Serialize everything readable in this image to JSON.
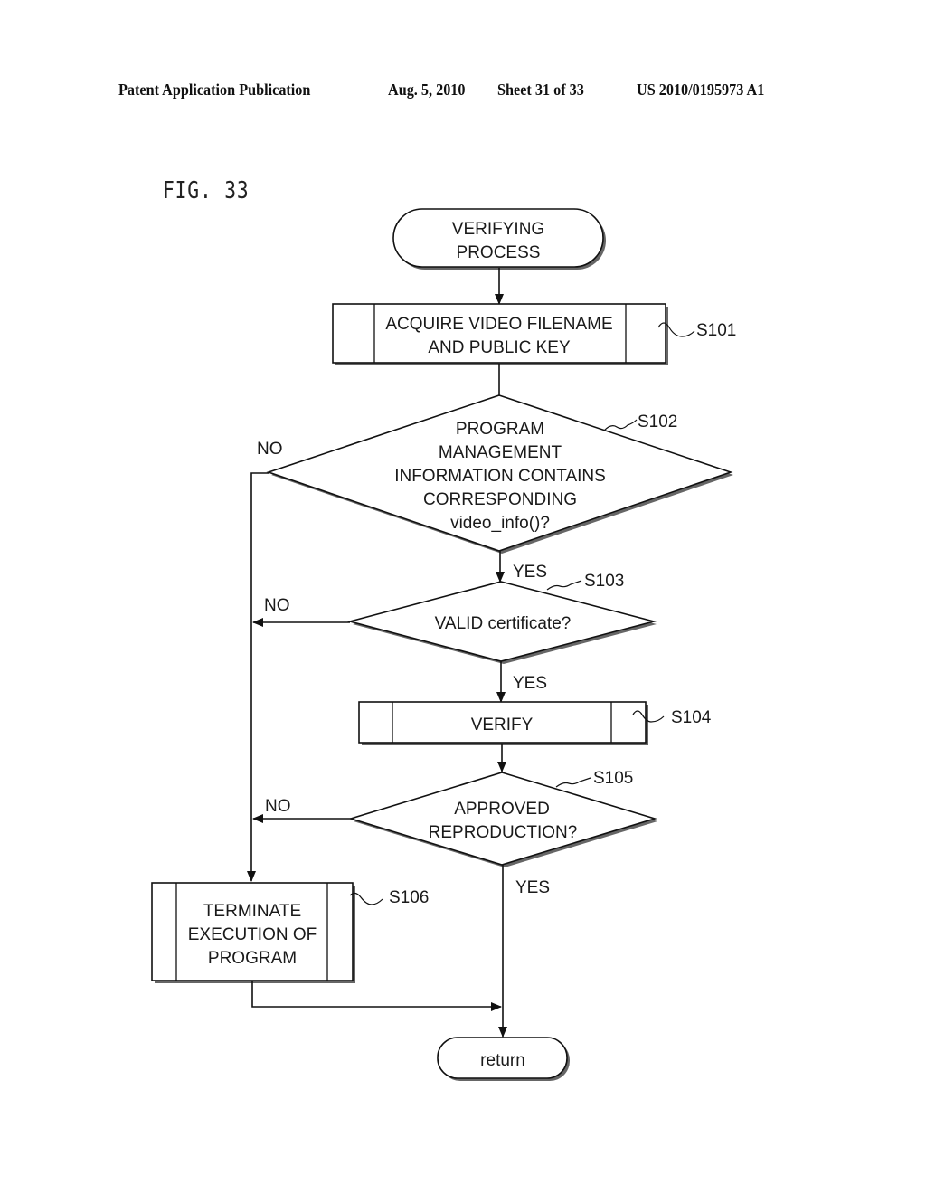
{
  "header": {
    "publication": "Patent Application Publication",
    "date": "Aug. 5, 2010",
    "sheet": "Sheet 31 of 33",
    "number": "US 2010/0195973 A1"
  },
  "figure": {
    "label": "FIG. 33"
  },
  "flowchart": {
    "start": {
      "lines": [
        "VERIFYING",
        "PROCESS"
      ]
    },
    "s101": {
      "step": "S101",
      "lines": [
        "ACQUIRE VIDEO FILENAME",
        "AND PUBLIC KEY"
      ]
    },
    "s102": {
      "step": "S102",
      "lines": [
        "PROGRAM",
        "MANAGEMENT",
        "INFORMATION CONTAINS",
        "CORRESPONDING",
        "video_info()?"
      ],
      "yes": "YES",
      "no": "NO"
    },
    "s103": {
      "step": "S103",
      "lines": [
        "VALID certificate?"
      ],
      "yes": "YES",
      "no": "NO"
    },
    "s104": {
      "step": "S104",
      "lines": [
        "VERIFY"
      ]
    },
    "s105": {
      "step": "S105",
      "lines": [
        "APPROVED",
        "REPRODUCTION?"
      ],
      "yes": "YES",
      "no": "NO"
    },
    "s106": {
      "step": "S106",
      "lines": [
        "TERMINATE",
        "EXECUTION OF",
        "PROGRAM"
      ]
    },
    "end": {
      "lines": [
        "return"
      ]
    }
  }
}
